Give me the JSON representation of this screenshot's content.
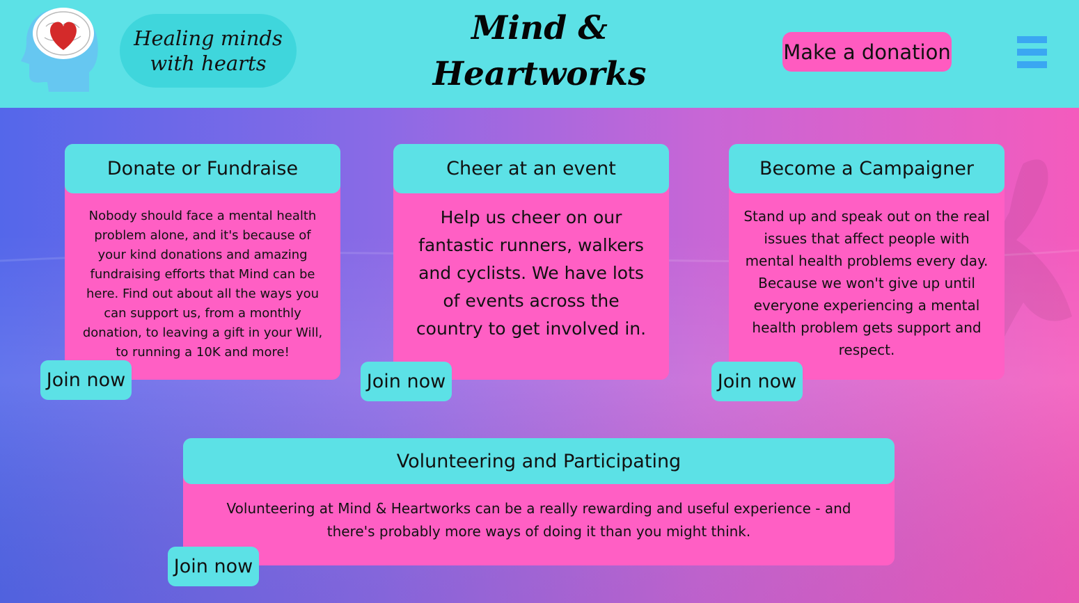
{
  "header": {
    "tagline": "Healing minds\nwith hearts",
    "site_title": "Mind &\nHeartworks",
    "donate_label": "Make a donation"
  },
  "cards": [
    {
      "title": "Donate or Fundraise",
      "body": "Nobody should face a mental health problem alone, and it's because of your kind donations and amazing fundraising efforts that Mind can be here. Find out about all the ways you can support us, from a monthly donation, to leaving a gift in your Will, to running a 10K and more!",
      "button": "Join now"
    },
    {
      "title": "Cheer at an event",
      "body": "Help us cheer on our fantastic runners, walkers and cyclists. We have lots of events across the country to get involved in.",
      "button": "Join now"
    },
    {
      "title": "Become a Campaigner",
      "body": "Stand up and speak out on the real issues that affect people with mental health problems every day. Because we won't give up until everyone experiencing a mental health problem gets support and respect.",
      "button": "Join now"
    },
    {
      "title": "Volunteering and Participating",
      "body": "Volunteering at Mind & Heartworks can be a really rewarding and useful experience - and there's probably more ways of doing it than you might think.",
      "button": "Join now"
    }
  ],
  "colors": {
    "header_bg": "#5ce1e6",
    "card_bg": "#ff5fc4",
    "accent_cyan": "#5ce1e6",
    "menu_icon": "#3aa7f2"
  },
  "icons": [
    "head-heart-logo-icon",
    "hamburger-menu-icon"
  ]
}
